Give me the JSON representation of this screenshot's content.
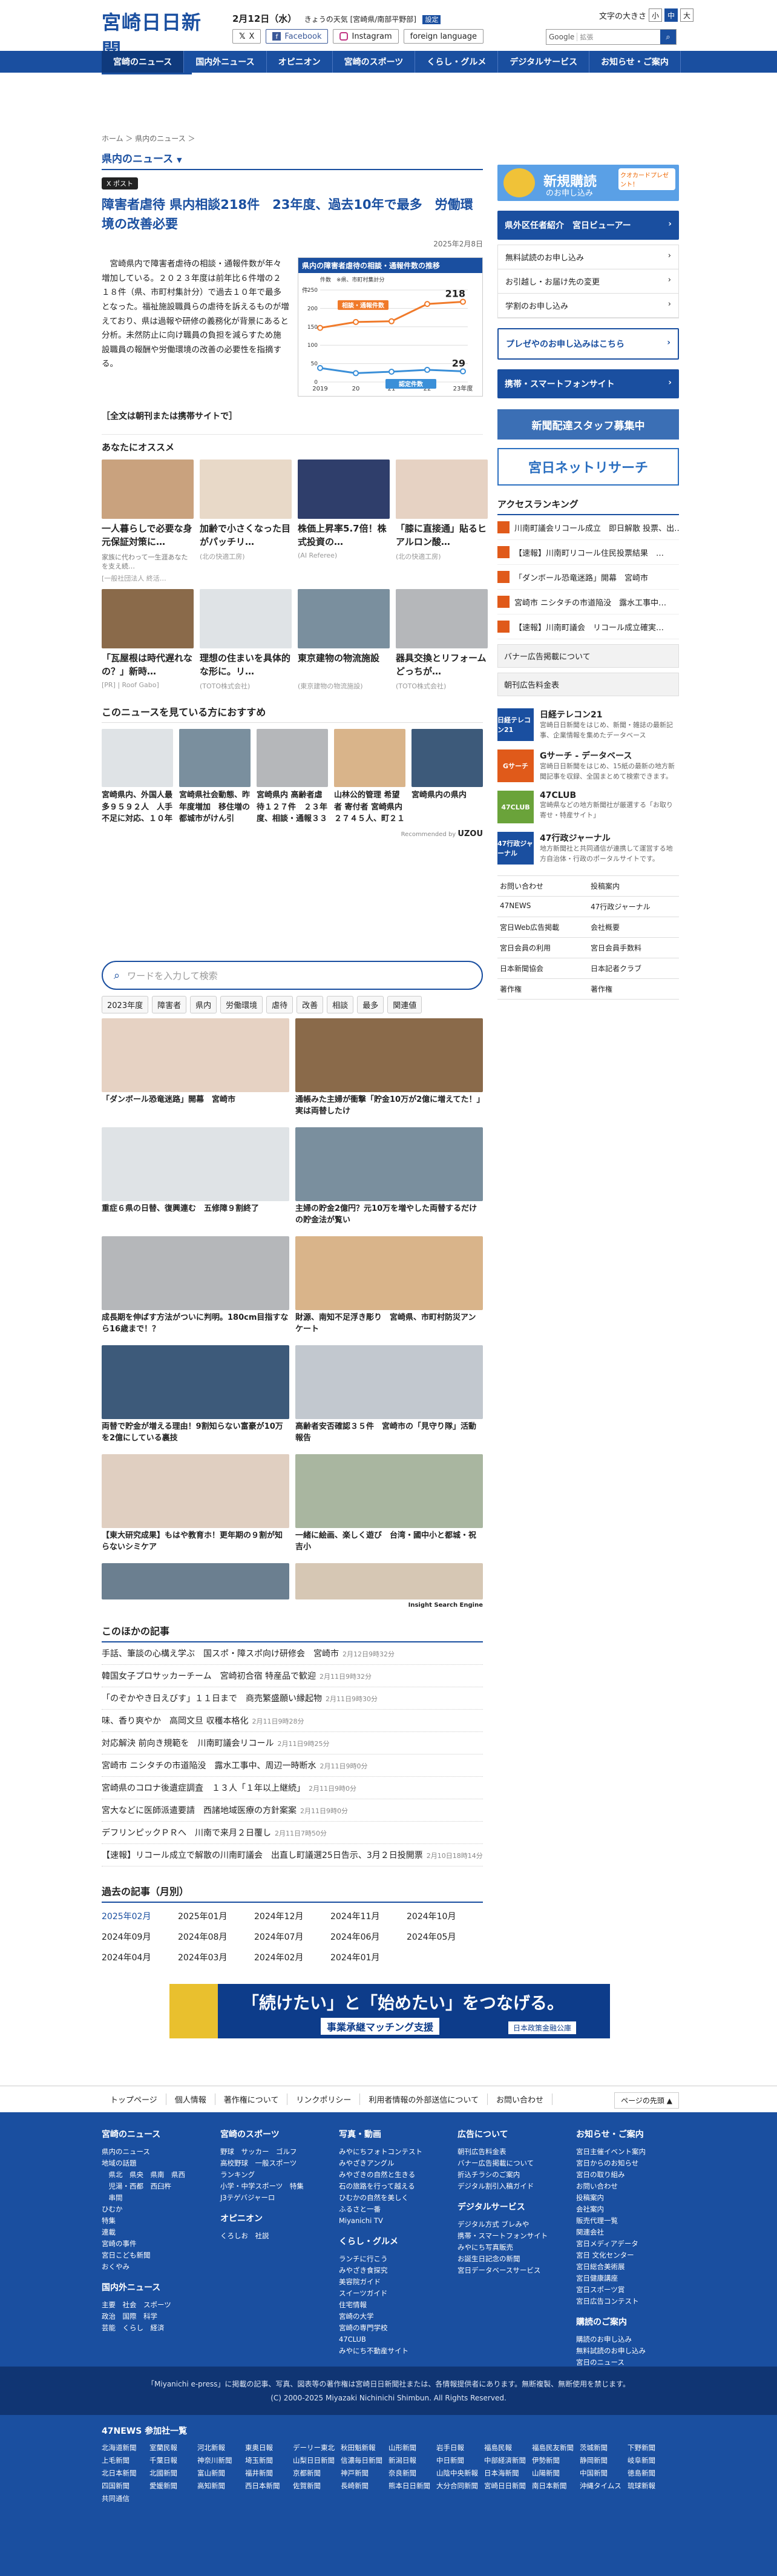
{
  "header": {
    "logo_jp": "宮崎日日新聞",
    "logo_en": "MIYANICHI e-PRESS",
    "date": "2月12日（水）",
    "weather": "きょうの天気 [宮崎県/南部平野部]",
    "settings": "設定",
    "font_size_label": "文字の大きさ",
    "font_sizes": [
      "小",
      "中",
      "大"
    ],
    "sns": [
      "X",
      "Facebook",
      "Instagram"
    ],
    "foreign": "foreign language",
    "search_brand": "Google",
    "search_placeholder": "拡張"
  },
  "nav": [
    "宮崎のニュース",
    "国内外ニュース",
    "オピニオン",
    "宮崎のスポーツ",
    "くらし・グルメ",
    "デジタルサービス",
    "お知らせ・ご案内"
  ],
  "breadcrumb": "ホーム ＞ 県内のニュース ＞",
  "section_title": "県内のニュース",
  "article": {
    "tag": "X ポスト",
    "headline": "障害者虐待 県内相談218件　23年度、過去10年で最多　労働環境の改善必要",
    "date": "2025年2月8日",
    "body": "宮崎県内で障害者虐待の相談・通報件数が年々増加している。２０２３年度は前年比６件増の２１８件（県、市町村集計分）で過去１０年で最多となった。福祉施設職員らの虐待を訴えるものが増えており、県は過報や研修の義務化が背景にあると分析。未然防止に向け職員の負担を減らすため施設職員の報酬や労働環境の改善の必要性を指摘する。",
    "note": "［全文は朝刊または携帯サイトで］"
  },
  "chart_data": {
    "type": "line",
    "title": "県内の障害者虐待の相談・通報件数の推移",
    "subtitle": "件数　※県、市町村集計分",
    "ylabel": "件",
    "categories": [
      "2019",
      "20",
      "21",
      "22",
      "23年度"
    ],
    "series": [
      {
        "name": "相談・通報件数",
        "values": [
          147,
          163,
          165,
          212,
          218
        ]
      },
      {
        "name": "認定件数",
        "values": [
          38,
          24,
          28,
          33,
          29
        ]
      }
    ],
    "ylim": [
      0,
      250
    ],
    "yticks": [
      0,
      50,
      100,
      150,
      200,
      250
    ],
    "labels": {
      "last_a": "218",
      "last_b": "29"
    }
  },
  "reco": {
    "title": "あなたにオススメ",
    "items": [
      {
        "t": "一人暮らしで必要な身元保証対策に…",
        "d": "家族に代わって一生涯あなたを支え続…",
        "s": "[一般社団法人 終活…"
      },
      {
        "t": "加齢で小さくなった目がパッチリ…",
        "d": "",
        "s": "(北の快適工房)"
      },
      {
        "t": "株価上昇率5.7倍！株式投資の…",
        "d": "",
        "s": "(AI Referee)"
      },
      {
        "t": "「膝に直接通」貼るヒアルロン酸…",
        "d": "",
        "s": "(北の快適工房)"
      },
      {
        "t": "「瓦屋根は時代遅れなの？」新時…",
        "d": "",
        "s": "[PR] | Roof Gabo]"
      },
      {
        "t": "理想の住まいを具体的な形に。リ…",
        "d": "",
        "s": "(TOTO株式会社)"
      },
      {
        "t": "東京建物の物流施設",
        "d": "",
        "s": "(東京建物の物流施設)"
      },
      {
        "t": "器具交換とリフォームどっちが…",
        "d": "",
        "s": "(TOTO株式会社)"
      }
    ]
  },
  "watch": {
    "title": "このニュースを見ている方におすすめ",
    "items": [
      "宮崎県内、外国人最多９５９２人　人手不足に対応、１０年",
      "宮崎県社会動態、昨年度増加　移住増の都城市がけん引",
      "宮崎県内 高齢者虐待１２７件　２３年度、相談・通報３３",
      "山林公的管理 希望者 寄付者 宮崎県内２７４５人、町２１０",
      "宮崎県内の県内"
    ],
    "by": "Recommended by",
    "brand": "UZOU"
  },
  "search2": {
    "placeholder": "ワードを入力して検索",
    "keywords": [
      "2023年度",
      "障害者",
      "県内",
      "労働環境",
      "虐待",
      "改善",
      "相談",
      "最多",
      "関連値"
    ]
  },
  "gallery": [
    "「ダンボール恐竜迷路」開幕　宮崎市",
    "通帳みた主婦が衝撃「貯金10万が2億に増えてた！」実は両替したけ",
    "重症６県の日替、復興連む　五修障９割終了",
    "主婦の貯金2億円？元10万を増やした両替するだけの貯金法が覧い",
    "成長期を伸ばす方法がついに判明。180cm目指すなら16歳まで！？",
    "財源、南知不足浮き彫り　宮崎県、市町村防災アンケート",
    "両替で貯金が増える理由！9割知らない富豪が10万を2億にしている裏技",
    "高齢者安否確認３５件　宮崎市の「見守り隊」活動報告",
    "【東大研究成果】もはや教育ホ！更年期の９割が知らないシミケア",
    "一緒に絵画、楽しく遊び　台湾・國中小と都城・祝吉小",
    "",
    ""
  ],
  "gallery_brand": "Insight Search Engine",
  "other": {
    "title": "このほかの記事",
    "items": [
      {
        "t": "手話、筆談の心構え学ぶ　国スポ・障スポ向け研修会　宮崎市",
        "d": "2月12日9時32分"
      },
      {
        "t": "韓国女子プロサッカーチーム　宮崎初合宿 特産品で歓迎",
        "d": "2月11日9時32分"
      },
      {
        "t": "「のぞかやき日えびす」１１日まで　商売繁盛願い縁起物",
        "d": "2月11日9時30分"
      },
      {
        "t": "味、香り爽やか　高岡文旦 収穫本格化",
        "d": "2月11日9時28分"
      },
      {
        "t": "対応解決 前向き規範を　川南町議会リコール",
        "d": "2月11日9時25分"
      },
      {
        "t": "宮崎市 ニシタチの市道陥没　露水工事中、周辺一時断水",
        "d": "2月11日9時0分"
      },
      {
        "t": "宮崎県のコロナ後遺症調査　１３人「１年以上継続」",
        "d": "2月11日9時0分"
      },
      {
        "t": "宮大などに医師派遣要請　西諸地域医療の方針案案",
        "d": "2月11日9時0分"
      },
      {
        "t": "デフリンピックＰＲへ　川南で来月２日覆し",
        "d": "2月11日7時50分"
      },
      {
        "t": "【速報】リコール成立で解散の川南町議会　出直し町議選25日告示、3月２日投開票",
        "d": "2月10日18時14分"
      }
    ]
  },
  "archive": {
    "title": "過去の記事（月別）",
    "months": [
      "2025年02月",
      "2025年01月",
      "2024年12月",
      "2024年11月",
      "2024年10月",
      "2024年09月",
      "2024年08月",
      "2024年07月",
      "2024年06月",
      "2024年05月",
      "2024年04月",
      "2024年03月",
      "2024年02月",
      "2024年01月",
      ""
    ]
  },
  "banner": {
    "main": "「続けたい」と「始めたい」をつなげる。",
    "sub": "事業承継マッチング支援",
    "org": "日本政策金融公庫"
  },
  "side": {
    "ad1_main": "新規購読",
    "ad1_sub": "のお申し込み",
    "ad1_badge": "クオカードプレゼント！",
    "btns": [
      "県外区任者紹介　宮日ビューアー"
    ],
    "list": [
      "無料試読のお申し込み",
      "お引越し・お届け先の変更",
      "学割のお申し込み"
    ],
    "btn2": "プレゼやのお申し込みはこちら",
    "btn3": "携帯・スマートフォンサイト",
    "ad2": "新聞配達スタッフ募集中",
    "ad3": "宮日ネットリサーチ",
    "rank_title": "アクセスランキング",
    "rank": [
      "川南町議会リコール成立　即日解散 投票、出…",
      "【速報】川南町リコール住民投票結果　…",
      "「ダンボール恐竜迷路」開幕　宮崎市",
      "宮崎市 ニシタチの市道陥没　露水工事中…",
      "【速報】川南町議会　リコール成立確実…"
    ],
    "gray": [
      "バナー広告掲載について",
      "朝刊広告料金表"
    ],
    "svc": [
      {
        "lg": "日経テレコン21",
        "t": "日経テレコン21",
        "d": "宮崎日日新聞をはじめ、新聞・雑誌の最新記事、企業情報を集めたデータベース"
      },
      {
        "lg": "Gサーチ",
        "t": "Gサーチ - データベース",
        "d": "宮崎日日新聞をはじめ、15紙の最新の地方新聞記事を収録、全国まとめて検索できます。"
      },
      {
        "lg": "47CLUB",
        "t": "47CLUB",
        "d": "宮崎県などの地方新聞社が厳選する「お取り寄せ・特産サイト」"
      },
      {
        "lg": "47行政ジャーナル",
        "t": "47行政ジャーナル",
        "d": "地方新聞社と共同通信が連携して運営する地方自治体・行政のポータルサイトです。"
      }
    ],
    "links": [
      "お問い合わせ",
      "投稿案内",
      "47NEWS",
      "47行政ジャーナル",
      "宮日Web広告掲載",
      "会社概要",
      "宮日会員の利用",
      "宮日会員手数料",
      "日本新聞協会",
      "日本記者クラブ",
      "著作権",
      "著作権"
    ]
  },
  "subfoot": {
    "items": [
      "トップページ",
      "個人情報",
      "著作権について",
      "リンクポリシー",
      "利用者情報の外部送信について",
      "お問い合わせ"
    ],
    "pagetop": "ページの先頭"
  },
  "footer": {
    "cols": [
      {
        "h": "宮崎のニュース",
        "p": [
          "県内のニュース",
          "地域の話題",
          "　県北　県央　県南　県西",
          "　児湯・西都　西臼杵",
          "　串間",
          "ひむか",
          "特集",
          "連載",
          "宮崎の事件",
          "宮日こども新聞",
          "おくやみ"
        ]
      },
      {
        "h": "宮崎のスポーツ",
        "p": [
          "野球　サッカー　ゴルフ",
          "高校野球　一般スポーツ",
          "ランキング",
          "小学・中学スポーツ　特集",
          "J3テゲバジャーロ"
        ]
      },
      {
        "h": "写真・動画",
        "p": [
          "みやにちフォトコンテスト",
          "みやざきアングル",
          "みやざきの自然と生きる",
          "石の旅路を行って越える",
          "ひむかの自然を美しく",
          "ふるさと一番",
          "Miyanichi TV"
        ]
      },
      {
        "h": "広告について",
        "p": [
          "朝刊広告料金表",
          "バナー広告掲載について",
          "折込チラシのご案内",
          "デジタル割引入稿ガイド"
        ]
      },
      {
        "h": "お知らせ・ご案内",
        "p": [
          "宮日主催イベント案内",
          "宮日からのお知らせ",
          "宮日の取り組み",
          "お問い合わせ",
          "投稿案内",
          "会社案内",
          "販売代理一覧",
          "関連会社",
          "宮日メディアデータ",
          "宮日 文化センター",
          "宮日総合美術展",
          "宮日健康講座",
          "宮日スポーツ賞",
          "宮日広告コンテスト"
        ]
      }
    ],
    "cols2": [
      {
        "h": "国内外ニュース",
        "p": [
          "主要　社会　スポーツ",
          "政治　国際　科学",
          "芸能　くらし　経済"
        ]
      },
      {
        "h": "オピニオン",
        "p": [
          "くろしお　社説"
        ]
      },
      {
        "h": "くらし・グルメ",
        "p": [
          "ランチに行こう",
          "みやざき食探究",
          "美容院ガイド",
          "スイーツガイド",
          "住宅情報",
          "宮崎の大学",
          "宮崎の専門学校",
          "47CLUB",
          "みやにち不動産サイト"
        ]
      },
      {
        "h": "デジタルサービス",
        "p": [
          "デジタル方式 ブレみや",
          "携帯・スマートフォンサイト",
          "みやにち写真販売",
          "お誕生日記念の新聞",
          "宮日データベースサービス"
        ]
      },
      {
        "h": "購読のご案内",
        "p": [
          "購読のお申し込み",
          "無料試読のお申し込み",
          "宮日のニュース",
          "携帯・スマートフォンサイト"
        ]
      }
    ]
  },
  "copyright": {
    "l1": "「Miyanichi e-press」に掲載の記事、写真、図表等の著作権は宮崎日日新聞社または、各情報提供者にあります。無断複製、無断使用を禁じます。",
    "l2": "(C) 2000-2025 Miyazaki Nichinichi Shimbun. All Rights Reserved."
  },
  "n47": {
    "title": "47NEWS 参加社一覧",
    "list": [
      "北海道新聞",
      "室蘭民報",
      "河北新報",
      "東奥日報",
      "デーリー東北",
      "秋田魁新報",
      "山形新聞",
      "岩手日報",
      "福島民報",
      "福島民友新聞",
      "茨城新聞",
      "下野新聞",
      "上毛新聞",
      "千葉日報",
      "神奈川新聞",
      "埼玉新聞",
      "山梨日日新聞",
      "信濃毎日新聞",
      "新潟日報",
      "中日新聞",
      "中部経済新聞",
      "伊勢新聞",
      "静岡新聞",
      "岐阜新聞",
      "北日本新聞",
      "北國新聞",
      "富山新聞",
      "福井新聞",
      "京都新聞",
      "神戸新聞",
      "奈良新聞",
      "山陰中央新報",
      "日本海新聞",
      "山陽新聞",
      "中国新聞",
      "徳島新聞",
      "四国新聞",
      "愛媛新聞",
      "高知新聞",
      "西日本新聞",
      "佐賀新聞",
      "長崎新聞",
      "熊本日日新聞",
      "大分合同新聞",
      "宮崎日日新聞",
      "南日本新聞",
      "沖縄タイムス",
      "琉球新報",
      "共同通信"
    ]
  }
}
